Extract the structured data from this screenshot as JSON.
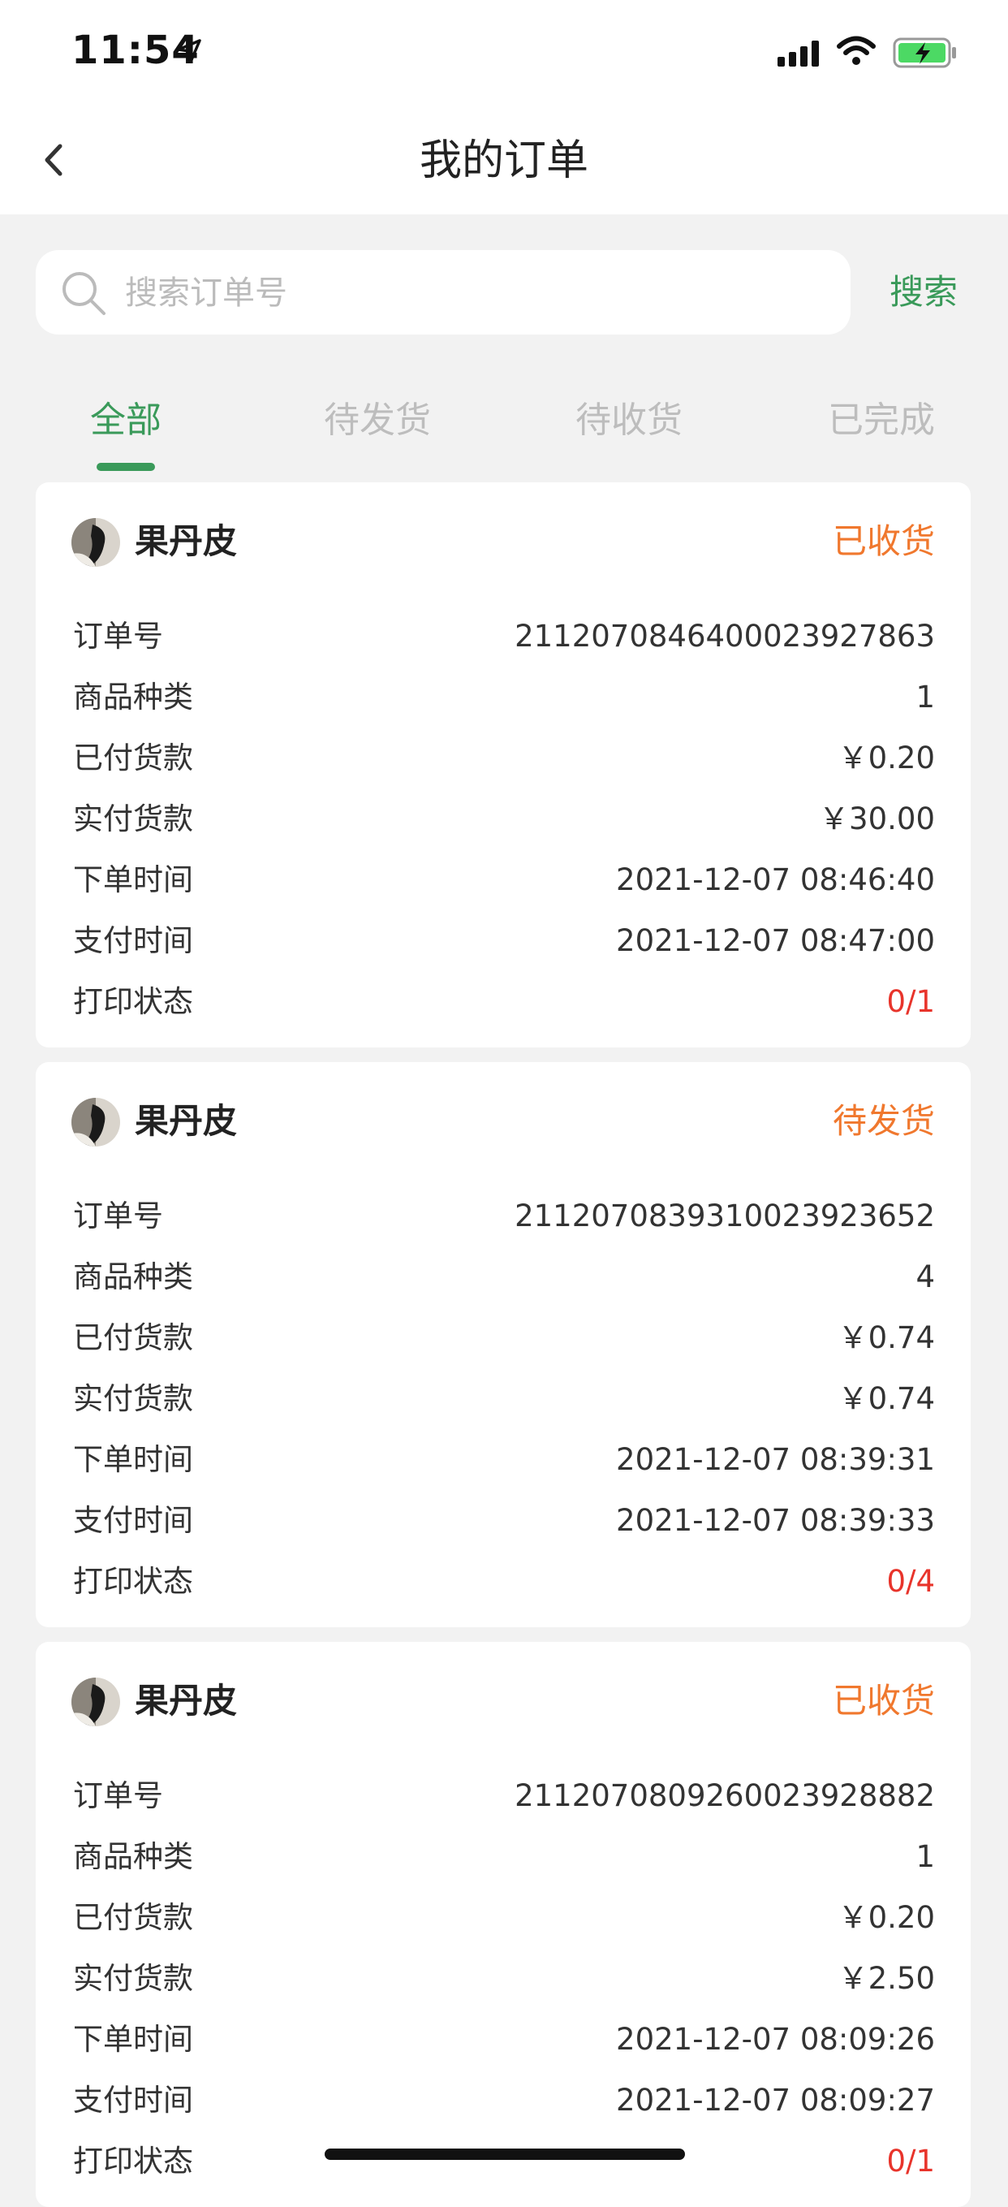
{
  "status_bar": {
    "time": "11:54",
    "icons": [
      "location-arrow-icon",
      "cellular-signal-icon",
      "wifi-icon",
      "battery-charging-icon"
    ]
  },
  "nav": {
    "title": "我的订单",
    "back_icon": "chevron-left-icon"
  },
  "search": {
    "placeholder": "搜索订单号",
    "value": "",
    "button_label": "搜索",
    "icon": "search-icon"
  },
  "tabs": [
    {
      "label": "全部",
      "active": true
    },
    {
      "label": "待发货",
      "active": false
    },
    {
      "label": "待收货",
      "active": false
    },
    {
      "label": "已完成",
      "active": false
    }
  ],
  "row_labels": [
    "订单号",
    "商品种类",
    "已付货款",
    "实付货款",
    "下单时间",
    "支付时间",
    "打印状态"
  ],
  "orders": [
    {
      "shop_name": "果丹皮",
      "status": "已收货",
      "values": [
        "211207084640002392786​3",
        "1",
        "￥0.20",
        "￥30.00",
        "2021-12-07 08:46:40",
        "2021-12-07 08:47:00",
        "0/1"
      ]
    },
    {
      "shop_name": "果丹皮",
      "status": "待发货",
      "values": [
        "211207083931002392365​2",
        "4",
        "￥0.74",
        "￥0.74",
        "2021-12-07 08:39:31",
        "2021-12-07 08:39:33",
        "0/4"
      ]
    },
    {
      "shop_name": "果丹皮",
      "status": "已收货",
      "values": [
        "211207080926002392888​2",
        "1",
        "￥0.20",
        "￥2.50",
        "2021-12-07 08:09:26",
        "2021-12-07 08:09:27",
        "0/1"
      ]
    }
  ],
  "colors": {
    "accent_green": "#3a9a5a",
    "status_orange": "#f0782e",
    "print_red": "#e8342b",
    "background": "#f2f2f2"
  }
}
